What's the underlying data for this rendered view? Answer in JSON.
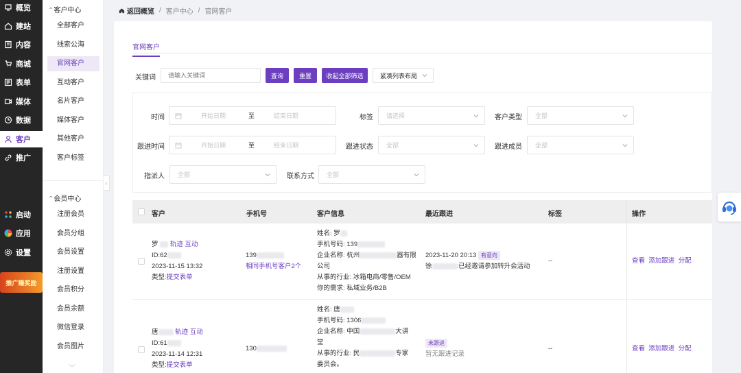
{
  "nav": {
    "items": [
      {
        "label": "概览",
        "icon": "overview-icon"
      },
      {
        "label": "建站",
        "icon": "home-icon"
      },
      {
        "label": "内容",
        "icon": "content-icon"
      },
      {
        "label": "商城",
        "icon": "cart-icon"
      },
      {
        "label": "表单",
        "icon": "form-icon"
      },
      {
        "label": "媒体",
        "icon": "video-icon"
      },
      {
        "label": "数据",
        "icon": "data-icon"
      },
      {
        "label": "客户",
        "icon": "user-icon"
      },
      {
        "label": "推广",
        "icon": "link-icon"
      }
    ],
    "bottom": [
      {
        "label": "启动",
        "icon": "launch-icon"
      },
      {
        "label": "应用",
        "icon": "apps-icon"
      },
      {
        "label": "设置",
        "icon": "gear-icon"
      }
    ],
    "promo": "推广赚奖励"
  },
  "subnav": {
    "group1": "客户中心",
    "items1": [
      "全部客户",
      "线索公海",
      "官网客户",
      "互动客户",
      "名片客户",
      "媒体客户",
      "其他客户",
      "客户标签"
    ],
    "group2": "会员中心",
    "items2": [
      "注册会员",
      "会员分组",
      "会员设置",
      "注册设置",
      "会员积分",
      "会员余额",
      "微信登录",
      "会员图片"
    ]
  },
  "breadcrumb": {
    "back": "返回概览",
    "sep": "/",
    "level1": "客户中心",
    "level2": "官网客户"
  },
  "tab": "官网客户",
  "search": {
    "label": "关键词",
    "placeholder": "请输入关键词",
    "query_btn": "查询",
    "reset_btn": "重置",
    "collapse_btn": "收起全部筛选",
    "layout_select": "紧凑列表布局"
  },
  "filters": {
    "time_label": "时间",
    "start_ph": "开始日期",
    "to": "至",
    "end_ph": "结束日期",
    "tag_label": "标签",
    "tag_ph": "请选择",
    "type_label": "客户类型",
    "all": "全部",
    "follow_time_label": "跟进时间",
    "follow_status_label": "跟进状态",
    "follow_member_label": "跟进成员",
    "assignee_label": "指派人",
    "contact_label": "联系方式"
  },
  "table": {
    "headers": [
      "客户",
      "手机号",
      "客户信息",
      "最近跟进",
      "标签",
      "操作"
    ],
    "rows": [
      {
        "name": "罗",
        "trail": "轨迹",
        "interact": "互动",
        "id": "ID:62",
        "date": "2023-11-15 13:32",
        "type_prefix": "类型:",
        "type_link": "提交表单",
        "phone": "139",
        "same_phone": "相同手机号客户2个",
        "info": [
          "姓名: 罗",
          "手机号码: 139",
          "企业名称: 杭州",
          "器有限",
          "公司",
          "从事的行业: 冰箱电商/零售/OEM",
          "你的需求: 私域业务/B2B"
        ],
        "follow_time": "2023-11-20 20:13",
        "follow_tag": "有意向",
        "follow_person": "徐",
        "follow_text": ":已经邀请参加转升会活动",
        "tags": "--",
        "ops": [
          "查看",
          "添加跟进",
          "分配"
        ]
      },
      {
        "name": "唐",
        "trail": "轨迹",
        "interact": "互动",
        "id": "ID:61",
        "date": "2023-11-14 12:31",
        "type_prefix": "类型:",
        "type_link": "提交表单",
        "phone": "130",
        "info": [
          "姓名: 唐",
          "手机号码: 1306",
          "企业名称: 中国",
          "大讲",
          "堂",
          "从事的行业: 民",
          "专家",
          "委员会。"
        ],
        "follow_tag": "未跟进",
        "follow_text": "暂无跟进记录",
        "tags": "--",
        "ops": [
          "查看",
          "添加跟进",
          "分配"
        ]
      }
    ]
  },
  "colors": {
    "accent": "#6b3fbf",
    "sidebar": "#262626"
  }
}
